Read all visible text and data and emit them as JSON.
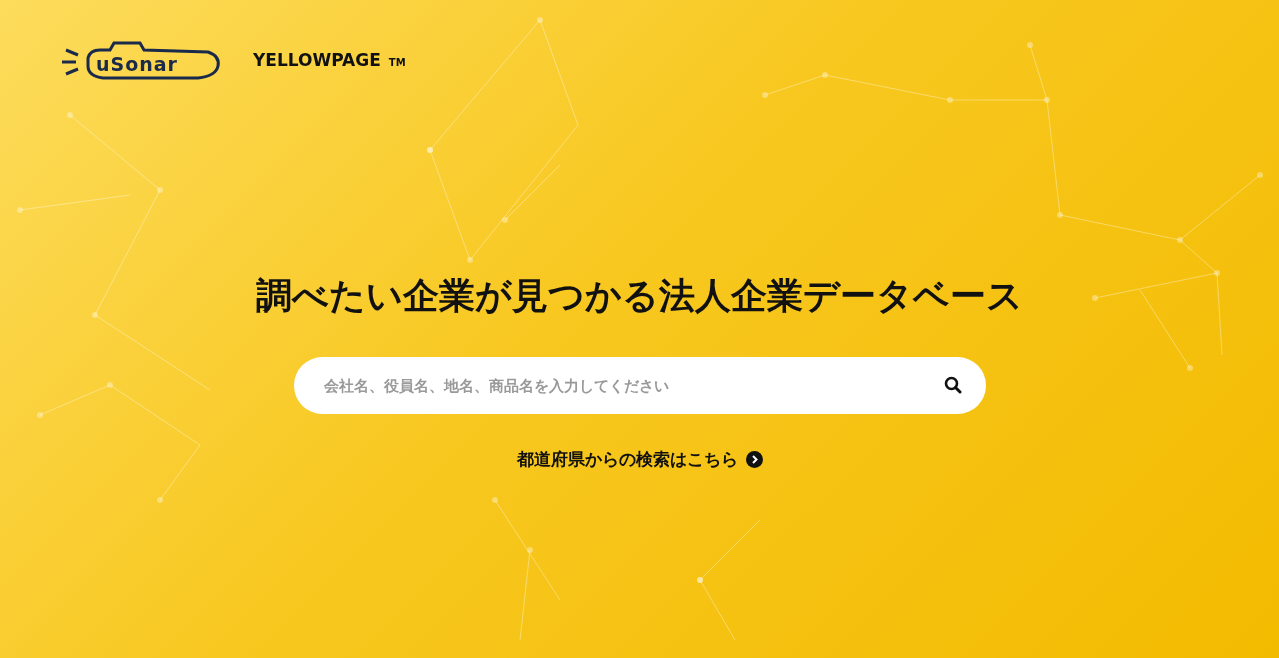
{
  "header": {
    "logo": "uSonar",
    "product": "YELLOWPAGE",
    "trademark": "TM"
  },
  "hero": {
    "headline": "調べたい企業が見つかる法人企業データベース"
  },
  "search": {
    "placeholder": "会社名、役員名、地名、商品名を入力してください"
  },
  "prefecture_link": {
    "label": "都道府県からの検索はこちら"
  }
}
